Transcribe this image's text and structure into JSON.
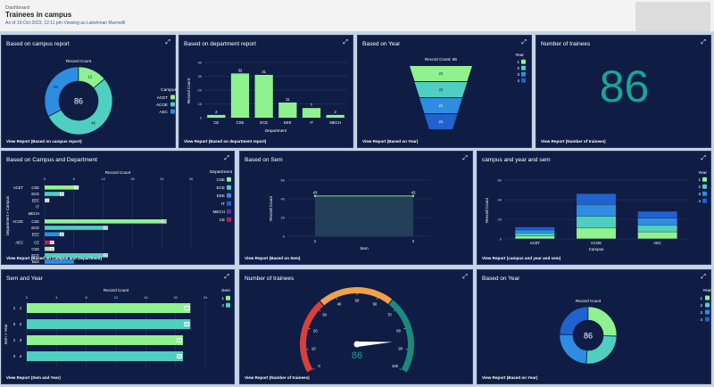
{
  "header": {
    "breadcrumb": "Dashboard",
    "title": "Trainees in campus",
    "subtitle": "As of 16-Oct-2023, 12:11 pm·Viewing as Lakshman Murmelli"
  },
  "icons": {
    "expand": "expand-icon"
  },
  "colors": {
    "panel_bg": "#0f1d44",
    "green": "#8ff28e",
    "teal": "#4fcfc0",
    "blue": "#2e8de0",
    "darkblue": "#2062d0",
    "grid": "#33466f",
    "gauge_red": "#d9403a",
    "gauge_orange": "#f0a24a",
    "gauge_teal": "#1a8a7e"
  },
  "panels": {
    "campus": {
      "title": "Based on campus report",
      "view_report": "View Report (Based on campus report)",
      "chart_data": {
        "type": "pie",
        "title": "Record Count",
        "legend_title": "Campus",
        "center_value": "86",
        "slices": [
          {
            "name": "ACET",
            "value": 12
          },
          {
            "name": "ACOE",
            "value": 46
          },
          {
            "name": "AEC",
            "value": 28
          }
        ]
      }
    },
    "dept": {
      "title": "Based on department report",
      "view_report": "View Report (Based on department report)",
      "chart_data": {
        "type": "bar",
        "xlabel": "Department",
        "ylabel": "Record Count",
        "ylim": [
          0,
          40
        ],
        "yticks": [
          0,
          10,
          20,
          30,
          40
        ],
        "categories": [
          "CE",
          "CSE",
          "ECE",
          "EEE",
          "IT",
          "MECH"
        ],
        "values": [
          2,
          32,
          31,
          11,
          7,
          2
        ]
      }
    },
    "year": {
      "title": "Based on Year",
      "view_report": "View Report (Based on Year)",
      "chart_data": {
        "type": "funnel",
        "title": "Record Count: 86",
        "legend_title": "Year",
        "categories": [
          "1",
          "2",
          "3",
          "4"
        ],
        "values": [
          22,
          22,
          21,
          21
        ]
      }
    },
    "trainees_metric": {
      "title": "Number of trainees",
      "value": "86",
      "view_report": "View Report (Number of trainees)"
    },
    "campus_dept": {
      "title": "Based on Campus and Department",
      "view_report": "View Report (Based on Campus and Department)",
      "chart_data": {
        "type": "bar",
        "orientation": "horizontal",
        "title": "Record Count",
        "ylabel": "Department > Campus",
        "legend_title": "Department",
        "xlim": [
          0,
          30
        ],
        "xticks": [
          0,
          6,
          12,
          18,
          24,
          30
        ],
        "legend": [
          "CSE",
          "ECE",
          "EEE",
          "IT",
          "MECH",
          "CE"
        ],
        "groups": [
          {
            "campus": "ACET",
            "rows": [
              {
                "dept": "CSE",
                "value": 7,
                "label": "7"
              },
              {
                "dept": "ECE",
                "value": 4,
                "label": "4"
              },
              {
                "dept": "EEE",
                "value": 1,
                "label": "1"
              },
              {
                "dept": "IT",
                "value": 0,
                "label": ""
              },
              {
                "dept": "MECH",
                "value": 0,
                "label": ""
              }
            ]
          },
          {
            "campus": "ACOE",
            "rows": [
              {
                "dept": "CSE",
                "value": 25,
                "label": "25"
              },
              {
                "dept": "ECE",
                "value": 13,
                "label": "13"
              },
              {
                "dept": "EEE",
                "value": 4,
                "label": "4"
              }
            ]
          },
          {
            "campus": "AEC",
            "rows": [
              {
                "dept": "CE",
                "value": 2,
                "label": "2"
              },
              {
                "dept": "CSE",
                "value": 2,
                "label": "2"
              },
              {
                "dept": "ECE",
                "value": 13,
                "label": "13"
              },
              {
                "dept": "EEE",
                "value": 6,
                "label": ""
              }
            ]
          }
        ]
      }
    },
    "sem": {
      "title": "Based on Sem",
      "view_report": "View Report (Based on Sem)",
      "chart_data": {
        "type": "area",
        "xlabel": "Sem",
        "ylabel": "Record Count",
        "ylim": [
          0,
          60
        ],
        "yticks": [
          0,
          20,
          40,
          60
        ],
        "x": [
          1,
          2
        ],
        "values": [
          43,
          43
        ]
      }
    },
    "campus_year_sem": {
      "title": "campus and year and sem",
      "view_report": "View Report (campus and year and sem)",
      "chart_data": {
        "type": "bar",
        "stacked": true,
        "xlabel": "Campus",
        "ylabel": "Record Count",
        "ylim": [
          0,
          60
        ],
        "yticks": [
          0,
          20,
          40,
          60
        ],
        "legend_title": "Year",
        "categories": [
          "ACET",
          "ACOE",
          "AEC"
        ],
        "series": [
          {
            "name": "1",
            "values": [
              3,
              11,
              7
            ]
          },
          {
            "name": "2",
            "values": [
              3,
              12,
              7
            ]
          },
          {
            "name": "3",
            "values": [
              3,
              12,
              7
            ]
          },
          {
            "name": "4",
            "values": [
              3,
              11,
              7
            ]
          }
        ]
      }
    },
    "sem_year": {
      "title": "Sem and Year",
      "view_report": "View Report (Sem and Year)",
      "chart_data": {
        "type": "bar",
        "orientation": "horizontal",
        "title": "Record Count",
        "ylabel": "Sem > Year",
        "legend_title": "Sem",
        "xlim": [
          0,
          24
        ],
        "xticks": [
          0,
          4,
          8,
          12,
          16,
          20,
          24
        ],
        "legend": [
          "1",
          "2"
        ],
        "rows": [
          {
            "sem": "1",
            "year": "1",
            "value": 22
          },
          {
            "sem": "2",
            "year": "2",
            "value": 22
          },
          {
            "sem": "1",
            "year": "3",
            "value": 21
          },
          {
            "sem": "2",
            "year": "4",
            "value": 21
          }
        ]
      }
    },
    "gauge": {
      "title": "Number of trainees",
      "view_report": "View Report (Number of trainees)",
      "chart_data": {
        "type": "gauge",
        "min": 0,
        "max": 100,
        "value": 86,
        "display": "86",
        "ticks": [
          0,
          10,
          20,
          30,
          40,
          50,
          60,
          70,
          80,
          90,
          100
        ],
        "bands": [
          [
            0,
            33
          ],
          [
            33,
            66
          ],
          [
            66,
            100
          ]
        ]
      }
    },
    "year_donut": {
      "title": "Based on Year",
      "view_report": "View Report (Based on Year)",
      "chart_data": {
        "type": "pie",
        "title": "Record Count",
        "legend_title": "Year",
        "center_value": "86",
        "slices": [
          {
            "name": "1",
            "value": 22
          },
          {
            "name": "2",
            "value": 22
          },
          {
            "name": "3",
            "value": 21
          },
          {
            "name": "4",
            "value": 21
          }
        ]
      }
    }
  }
}
